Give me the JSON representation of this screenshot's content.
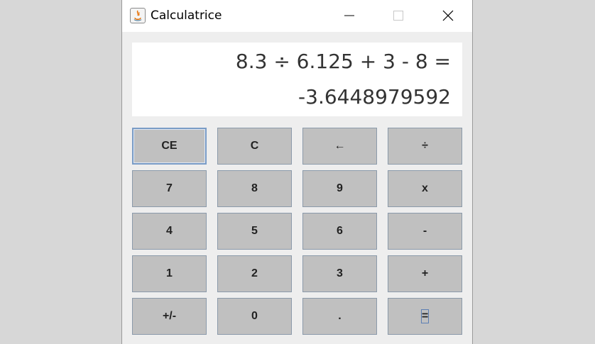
{
  "window": {
    "title": "Calculatrice",
    "controls": [
      "minimize",
      "maximize",
      "close"
    ]
  },
  "display": {
    "expression": "8.3 ÷ 6.125 + 3 - 8 =",
    "result": "-3.6448979592"
  },
  "keypad": {
    "rows": [
      [
        "CE",
        "C",
        "←",
        "÷"
      ],
      [
        "7",
        "8",
        "9",
        "x"
      ],
      [
        "4",
        "5",
        "6",
        "-"
      ],
      [
        "1",
        "2",
        "3",
        "+"
      ],
      [
        "+/-",
        "0",
        ".",
        "="
      ]
    ]
  }
}
